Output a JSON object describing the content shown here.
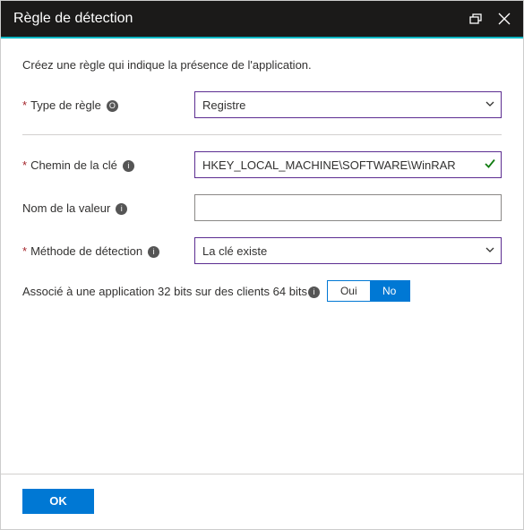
{
  "header": {
    "title": "Règle de détection"
  },
  "intro": "Créez une règle qui indique la présence de l'application.",
  "fields": {
    "ruleType": {
      "label": "Type de règle",
      "info": "O",
      "value": "Registre"
    },
    "keyPath": {
      "label": "Chemin de la clé",
      "value": "HKEY_LOCAL_MACHINE\\SOFTWARE\\WinRAR"
    },
    "valueName": {
      "label": "Nom de la valeur",
      "value": ""
    },
    "detectionMethod": {
      "label": "Méthode de détection",
      "value": "La clé existe"
    },
    "assoc32": {
      "label": "Associé à une application 32 bits sur des clients 64 bits",
      "yes": "Oui",
      "no": "No"
    }
  },
  "footer": {
    "ok": "OK"
  }
}
